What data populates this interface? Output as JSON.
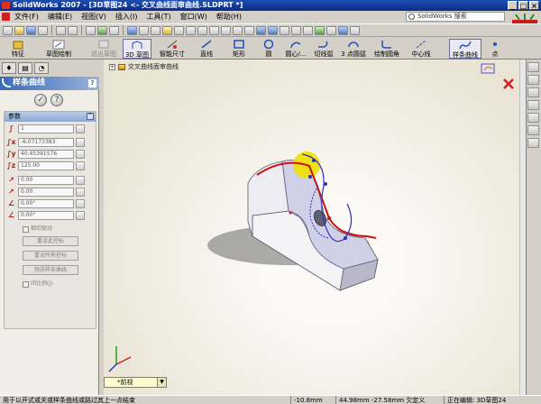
{
  "window": {
    "title": "SolidWorks 2007 - [3D草图24 <- 交叉曲线面审曲线.SLDPRT *]",
    "controls": [
      "_",
      "□",
      "×"
    ]
  },
  "menu": {
    "items": [
      "文件(F)",
      "编辑(E)",
      "视图(V)",
      "插入(I)",
      "工具(T)",
      "窗口(W)",
      "帮助(H)"
    ],
    "search_placeholder": "SolidWorks 搜索"
  },
  "command_manager": {
    "buttons": [
      {
        "label": "特征",
        "icon": "features-icon"
      },
      {
        "label": "草图绘制",
        "icon": "sketch-icon"
      },
      {
        "label": "退出草图",
        "icon": "exit-sketch-icon"
      },
      {
        "label": "3D 草图",
        "icon": "3d-sketch-icon"
      },
      {
        "label": "智能尺寸",
        "icon": "smart-dimension-icon"
      },
      {
        "label": "直线",
        "icon": "line-icon"
      },
      {
        "label": "矩形",
        "icon": "rectangle-icon"
      },
      {
        "label": "圆",
        "icon": "circle-icon"
      },
      {
        "label": "圆心/...",
        "icon": "arc-icon"
      },
      {
        "label": "切线弧",
        "icon": "tangent-arc-icon"
      },
      {
        "label": "3 点圆弧",
        "icon": "3point-arc-icon"
      },
      {
        "label": "绘制圆角",
        "icon": "fillet-icon"
      },
      {
        "label": "中心线",
        "icon": "centerline-icon"
      },
      {
        "label": "样条曲线",
        "icon": "spline-icon"
      },
      {
        "label": "点",
        "icon": "point-icon"
      }
    ]
  },
  "property_manager": {
    "title": "样条曲线",
    "group_title": "参数",
    "params": [
      {
        "icon": "N",
        "value": "1"
      },
      {
        "icon": "X",
        "value": "-6.07173383"
      },
      {
        "icon": "Y",
        "value": "40.45391576"
      },
      {
        "icon": "Z",
        "value": "125.00"
      },
      {
        "icon": "w",
        "value": "0.00"
      },
      {
        "icon": "w",
        "value": "0.00"
      },
      {
        "icon": "a",
        "value": "0.00°"
      },
      {
        "icon": "a",
        "value": "0.00°"
      }
    ],
    "options": {
      "relax_checkbox": "相切驱动",
      "reset_this": "重设此控标",
      "reset_all": "重设所有控标",
      "relax_spline": "弛张样条曲线",
      "closed_checkbox": "闭比例(J)"
    }
  },
  "viewport": {
    "tree_crumb": "交叉曲线面审曲线",
    "view_orientation": "*前视"
  },
  "status": {
    "message": "用于以开式或关或样条曲线或路过其上一点结束",
    "x": "-10.8mm",
    "coords": "44.98mm  -27.58mm 欠定义",
    "mode": "正在编辑: 3D草图24"
  },
  "colors": {
    "title_bar": "#0a2a88",
    "pm_header": "#3a6ab8",
    "spline_red": "#d01010",
    "spline_blue": "#3030c0",
    "handle_yellow": "#f0e000"
  }
}
